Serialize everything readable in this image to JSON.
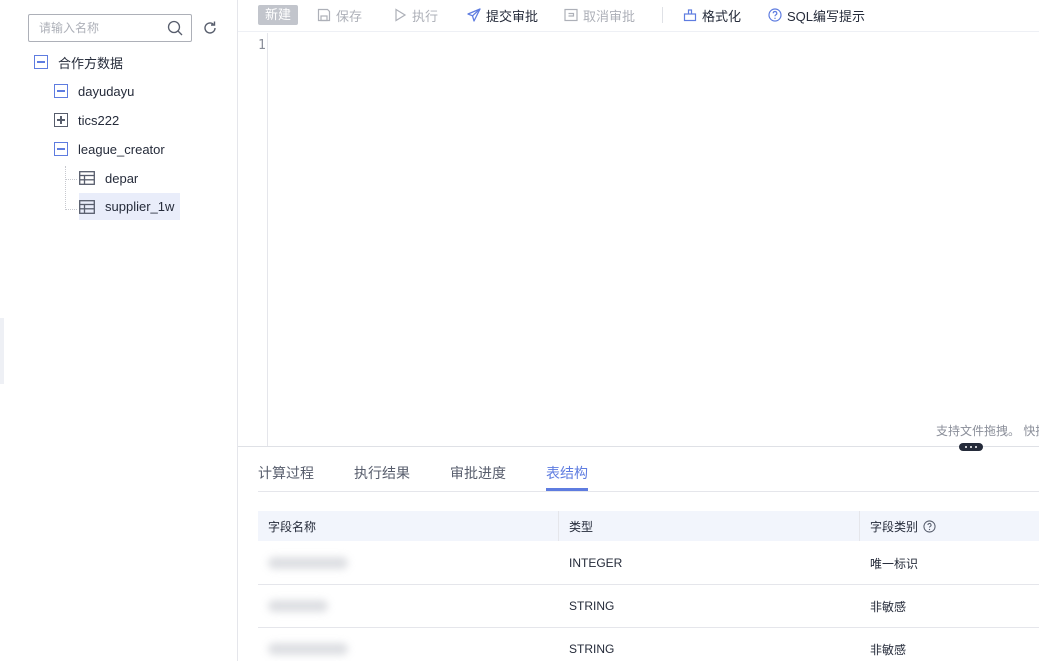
{
  "search": {
    "placeholder": "请输入名称"
  },
  "tree": {
    "root": "合作方数据",
    "nodes": [
      {
        "label": "dayudayu",
        "expanded": true
      },
      {
        "label": "tics222",
        "expanded": false
      },
      {
        "label": "league_creator",
        "expanded": true
      }
    ],
    "tables": [
      "depar",
      "supplier_1w"
    ]
  },
  "toolbar": {
    "new": "新建",
    "save": "保存",
    "run": "执行",
    "submit": "提交审批",
    "cancel": "取消审批",
    "format": "格式化",
    "sql_hint": "SQL编写提示"
  },
  "editor": {
    "line_number": "1",
    "hint": "支持文件拖拽。 快捷"
  },
  "tabs": [
    "计算过程",
    "执行结果",
    "审批进度",
    "表结构"
  ],
  "active_tab": "表结构",
  "table": {
    "headers": [
      "字段名称",
      "类型",
      "字段类别"
    ],
    "rows": [
      {
        "type": "INTEGER",
        "category": "唯一标识"
      },
      {
        "type": "STRING",
        "category": "非敏感"
      },
      {
        "type": "STRING",
        "category": "非敏感"
      }
    ]
  },
  "colors": {
    "accent": "#5e7ce0",
    "disabled": "#adb0b8",
    "header_bg": "#f2f5fc"
  }
}
